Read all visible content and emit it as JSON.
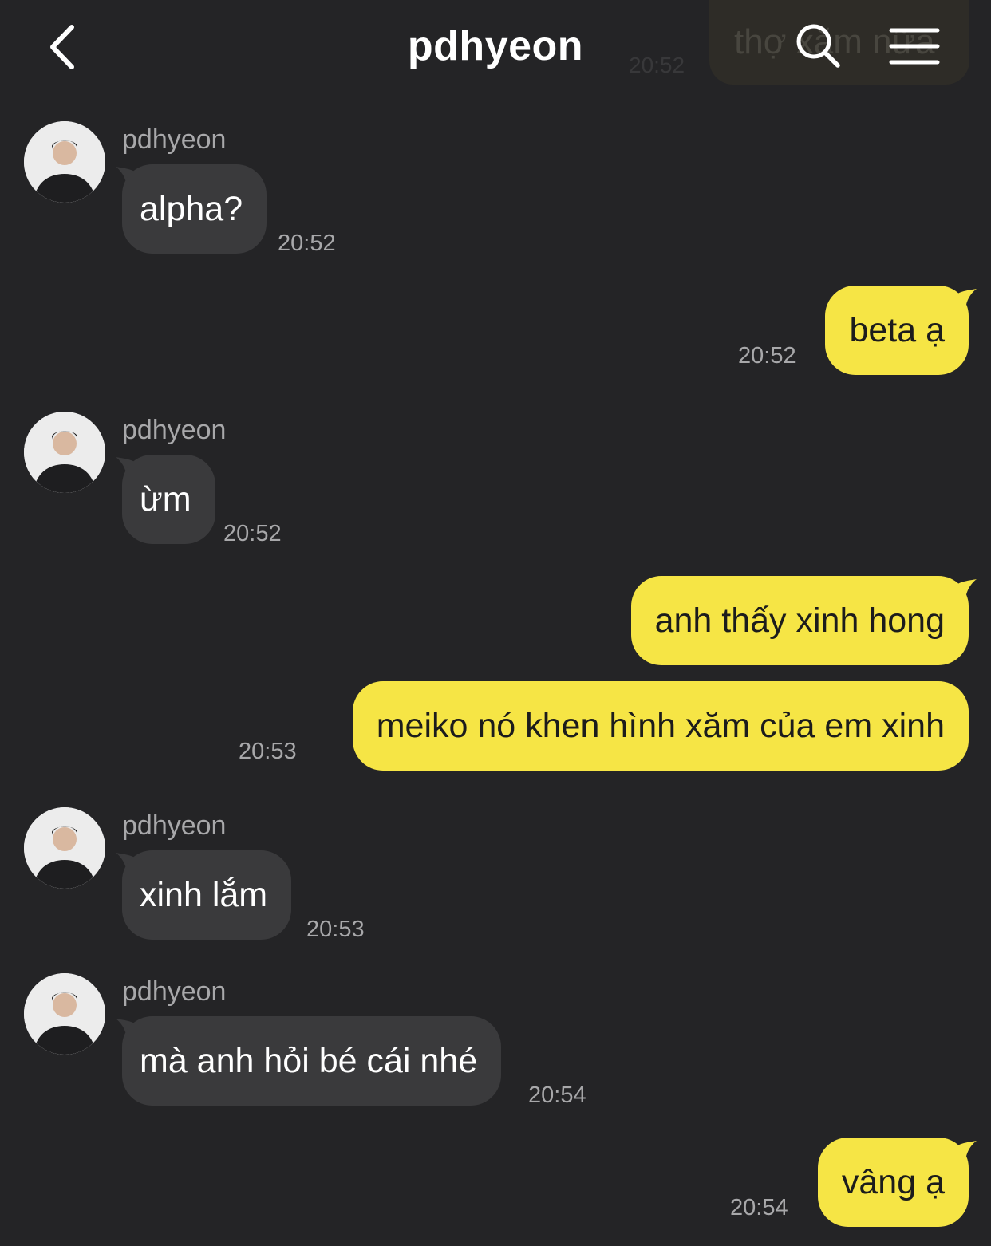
{
  "header": {
    "title": "pdhyeon",
    "ghost_message": "thợ xăm nữa",
    "ghost_time": "20:52"
  },
  "messages": [
    {
      "direction": "in",
      "sender": "pdhyeon",
      "text": "alpha?",
      "time": "20:52"
    },
    {
      "direction": "out",
      "text": "beta ạ",
      "time": "20:52"
    },
    {
      "direction": "in",
      "sender": "pdhyeon",
      "text": "ừm",
      "time": "20:52"
    },
    {
      "direction": "out",
      "text": "anh thấy xinh hong",
      "time": ""
    },
    {
      "direction": "out",
      "text": "meiko nó khen hình xăm của em xinh",
      "time": "20:53"
    },
    {
      "direction": "in",
      "sender": "pdhyeon",
      "text": "xinh lắm",
      "time": "20:53"
    },
    {
      "direction": "in",
      "sender": "pdhyeon",
      "text": "mà anh hỏi bé cái nhé",
      "time": "20:54"
    },
    {
      "direction": "out",
      "text": "vâng ạ",
      "time": "20:54"
    }
  ],
  "colors": {
    "background": "#242426",
    "incoming_bubble": "#3a3a3c",
    "outgoing_bubble": "#f6e545",
    "timestamp": "#a8a8aa"
  },
  "icons": [
    "chevron-left-icon",
    "search-icon",
    "menu-icon",
    "avatar"
  ]
}
